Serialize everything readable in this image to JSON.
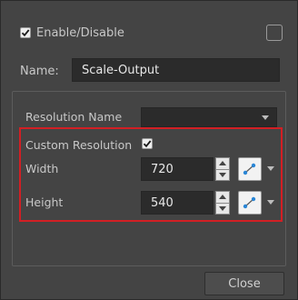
{
  "enable": {
    "label": "Enable/Disable",
    "checked": true
  },
  "name": {
    "label": "Name:",
    "value": "Scale-Output"
  },
  "resolution": {
    "label": "Resolution Name",
    "selected": ""
  },
  "custom": {
    "label": "Custom Resolution",
    "checked": true
  },
  "width": {
    "label": "Width",
    "value": "720"
  },
  "height": {
    "label": "Height",
    "value": "540"
  },
  "footer": {
    "close_label": "Close"
  },
  "colors": {
    "highlight": "#d21f24",
    "field_bg": "#2b2b2b",
    "panel_bg": "#444444"
  },
  "icons": [
    "check-icon",
    "spin-up-icon",
    "spin-down-icon",
    "link-icon",
    "chevron-down-icon"
  ]
}
